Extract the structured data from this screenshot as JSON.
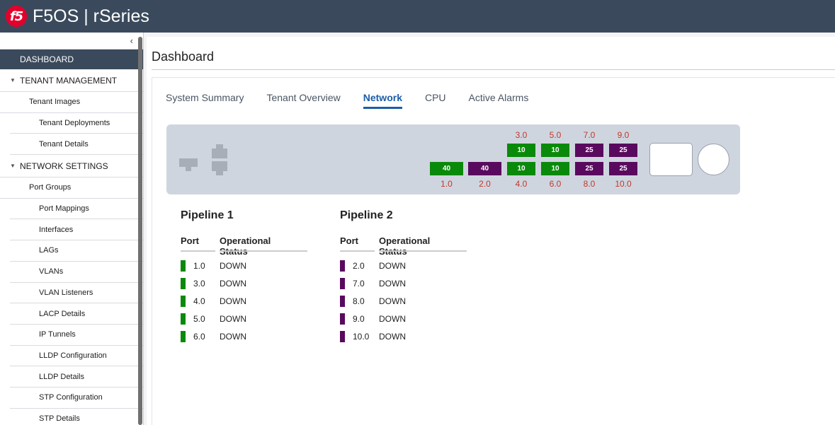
{
  "app": {
    "logo_text": "f5",
    "title": "F5OS | rSeries"
  },
  "sidebar": {
    "dashboard": "DASHBOARD",
    "sections": [
      {
        "label": "TENANT MANAGEMENT",
        "items": [
          "Tenant Images",
          "Tenant Deployments",
          "Tenant Details"
        ]
      },
      {
        "label": "NETWORK SETTINGS",
        "items": [
          "Port Groups",
          "Port Mappings",
          "Interfaces",
          "LAGs",
          "VLANs",
          "VLAN Listeners",
          "LACP Details",
          "IP Tunnels",
          "LLDP Configuration",
          "LLDP Details",
          "STP Configuration",
          "STP Details"
        ]
      }
    ]
  },
  "page": {
    "title": "Dashboard"
  },
  "tabs": [
    "System Summary",
    "Tenant Overview",
    "Network",
    "CPU",
    "Active Alarms"
  ],
  "active_tab": "Network",
  "colors": {
    "pipeline1": "#0a8a0a",
    "pipeline2": "#5a0a5e",
    "label": "#c0392b"
  },
  "chassis": {
    "ports": [
      {
        "id": "1.0",
        "speed": "40",
        "pipeline": 1
      },
      {
        "id": "2.0",
        "speed": "40",
        "pipeline": 2
      },
      {
        "id": "3.0",
        "speed": "10",
        "pipeline": 1
      },
      {
        "id": "4.0",
        "speed": "10",
        "pipeline": 1
      },
      {
        "id": "5.0",
        "speed": "10",
        "pipeline": 1
      },
      {
        "id": "6.0",
        "speed": "10",
        "pipeline": 1
      },
      {
        "id": "7.0",
        "speed": "25",
        "pipeline": 2
      },
      {
        "id": "8.0",
        "speed": "25",
        "pipeline": 2
      },
      {
        "id": "9.0",
        "speed": "25",
        "pipeline": 2
      },
      {
        "id": "10.0",
        "speed": "25",
        "pipeline": 2
      }
    ]
  },
  "pipelines": [
    {
      "title": "Pipeline 1",
      "col_port": "Port",
      "col_status": "Operational Status",
      "rows": [
        {
          "port": "1.0",
          "status": "DOWN"
        },
        {
          "port": "3.0",
          "status": "DOWN"
        },
        {
          "port": "4.0",
          "status": "DOWN"
        },
        {
          "port": "5.0",
          "status": "DOWN"
        },
        {
          "port": "6.0",
          "status": "DOWN"
        }
      ]
    },
    {
      "title": "Pipeline 2",
      "col_port": "Port",
      "col_status": "Operational Status",
      "rows": [
        {
          "port": "2.0",
          "status": "DOWN"
        },
        {
          "port": "7.0",
          "status": "DOWN"
        },
        {
          "port": "8.0",
          "status": "DOWN"
        },
        {
          "port": "9.0",
          "status": "DOWN"
        },
        {
          "port": "10.0",
          "status": "DOWN"
        }
      ]
    }
  ]
}
